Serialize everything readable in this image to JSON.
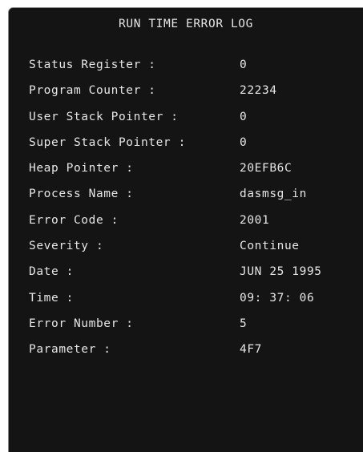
{
  "log": {
    "title": "RUN TIME ERROR LOG",
    "rows": [
      {
        "label": "Status Register :",
        "value": "0"
      },
      {
        "label": "Program Counter :",
        "value": "22234"
      },
      {
        "label": "User Stack Pointer :",
        "value": "0"
      },
      {
        "label": "Super Stack Pointer :",
        "value": "0"
      },
      {
        "label": "Heap Pointer :",
        "value": "20EFB6C"
      },
      {
        "label": "Process Name :",
        "value": "dasmsg_in"
      },
      {
        "label": "Error Code :",
        "value": "2001"
      },
      {
        "label": "Severity :",
        "value": "Continue"
      },
      {
        "label": "Date :",
        "value": "JUN 25 1995"
      },
      {
        "label": "Time :",
        "value": "09: 37: 06"
      },
      {
        "label": "Error Number :",
        "value": "5"
      },
      {
        "label": "Parameter :",
        "value": "4F7"
      }
    ]
  }
}
